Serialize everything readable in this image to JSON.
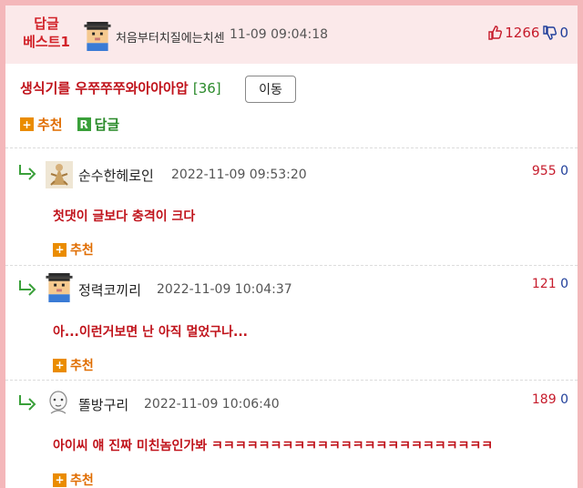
{
  "header": {
    "badge_line1": "답글",
    "badge_line2": "베스트1",
    "author": "처음부터치질에는치센",
    "time": "11-09 09:04:18",
    "up_votes": "1266",
    "down_votes": "0"
  },
  "post": {
    "title": "생식기를 우쭈쭈쭈와아아아압",
    "comment_count": "[36]",
    "move_label": "이동",
    "recommend_label": "추천",
    "reply_label": "답글",
    "reply_icon_letter": "R",
    "plus_symbol": "+"
  },
  "comments": [
    {
      "author": "순수한헤로인",
      "time": "2022-11-09 09:53:20",
      "up": "955",
      "down": "0",
      "text": "첫댓이 글보다 충격이 크다",
      "recommend": "추천"
    },
    {
      "author": "정력코끼리",
      "time": "2022-11-09 10:04:37",
      "up": "121",
      "down": "0",
      "text": "아...이런거보면 난 아직 멀었구나...",
      "recommend": "추천"
    },
    {
      "author": "똘방구리",
      "time": "2022-11-09 10:06:40",
      "up": "189",
      "down": "0",
      "text": "아이씨 얘 진짜 미친놈인가봐 ㅋㅋㅋㅋㅋㅋㅋㅋㅋㅋㅋㅋㅋㅋㅋㅋㅋㅋㅋㅋㅋㅋㅋㅋ",
      "recommend": "추천"
    }
  ],
  "colors": {
    "accent_red": "#c0131b",
    "recommend_orange": "#e06d00",
    "reply_green": "#2a8a2a",
    "downvote_blue": "#1f3e9a",
    "background_pink": "#f4b7ba"
  },
  "icons": [
    "pixel-avatar-icon",
    "thumbs-up-icon",
    "thumbs-down-icon",
    "reply-arrow-icon",
    "figurine-avatar-icon",
    "bald-face-avatar-icon"
  ]
}
